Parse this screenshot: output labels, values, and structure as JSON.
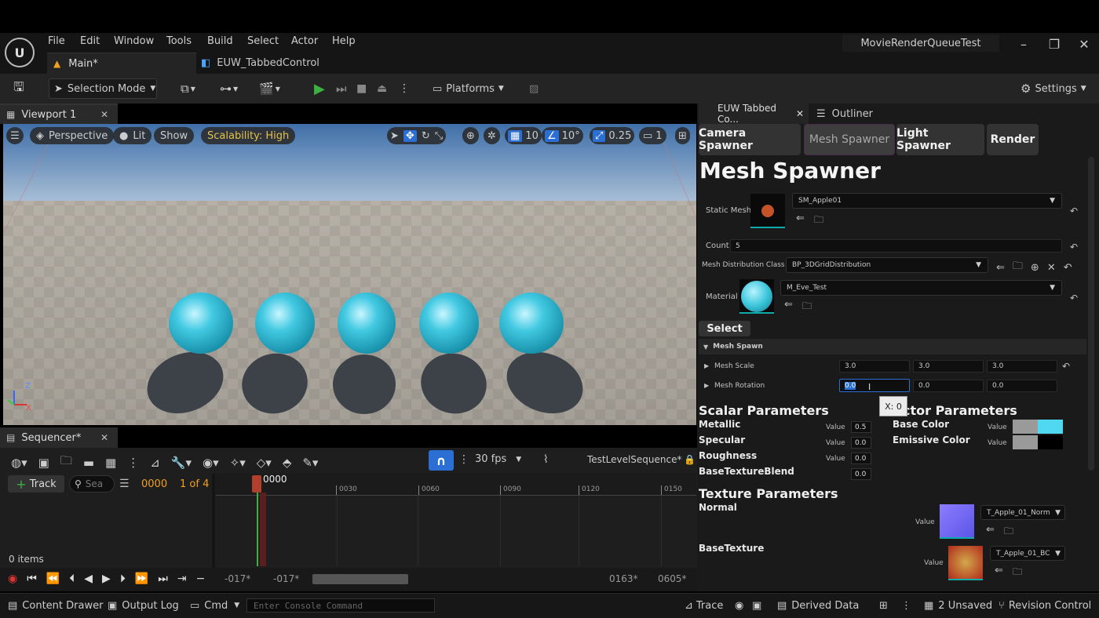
{
  "menu": [
    "File",
    "Edit",
    "Window",
    "Tools",
    "Build",
    "Select",
    "Actor",
    "Help"
  ],
  "tabs": {
    "main": "Main*",
    "euw": "EUW_TabbedControl"
  },
  "project_name": "MovieRenderQueueTest",
  "toolbar": {
    "selection_mode": "Selection Mode",
    "platforms": "Platforms",
    "settings": "Settings"
  },
  "viewport": {
    "tab": "Viewport 1",
    "perspective": "Perspective",
    "lit": "Lit",
    "show": "Show",
    "scalability": "Scalability: High",
    "grid": "10",
    "angle": "10°",
    "scale": "0.25",
    "cam_speed": "1",
    "axis_z": "Z",
    "axis_x": "X"
  },
  "panel": {
    "tab_euw": "EUW Tabbed Co...",
    "tab_outliner": "Outliner",
    "subtabs": [
      "Camera Spawner",
      "Mesh Spawner",
      "Light Spawner",
      "Render"
    ],
    "heading": "Mesh Spawner",
    "static_mesh_label": "Static Mesh",
    "static_mesh_value": "SM_Apple01",
    "count_label": "Count",
    "count_value": "5",
    "dist_label": "Mesh Distribution Class",
    "dist_value": "BP_3DGridDistribution",
    "material_label": "Material",
    "material_value": "M_Eve_Test",
    "select_btn": "Select",
    "mesh_spawn": "Mesh Spawn",
    "mesh_scale_label": "Mesh Scale",
    "mesh_scale": [
      "3.0",
      "3.0",
      "3.0"
    ],
    "mesh_rotation_label": "Mesh Rotation",
    "mesh_rotation": [
      "0.0",
      "0.0",
      "0.0"
    ],
    "tooltip": "X: 0",
    "scalar_title": "Scalar Parameters",
    "vector_title": "ctor Parameters",
    "scalar": [
      {
        "name": "Metallic",
        "value": "0.5"
      },
      {
        "name": "Specular",
        "value": "0.0"
      },
      {
        "name": "Roughness",
        "value": "0.0"
      },
      {
        "name": "BaseTextureBlend",
        "value": "0.0"
      }
    ],
    "vector": [
      {
        "name": "Base Color"
      },
      {
        "name": "Emissive Color"
      }
    ],
    "value_label": "Value",
    "texture_title": "Texture Parameters",
    "textures": [
      {
        "name": "Normal",
        "value": "T_Apple_01_Norm"
      },
      {
        "name": "BaseTexture",
        "value": "T_Apple_01_BC"
      }
    ]
  },
  "sequencer": {
    "tab": "Sequencer*",
    "fps": "30 fps",
    "sequence": "TestLevelSequence*",
    "track_btn": "Track",
    "search_ph": "Sea",
    "frame": "0000",
    "of": "1 of 4",
    "items": "0 items",
    "playhead": "0000",
    "ticks": [
      "0030",
      "0060",
      "0090",
      "0120",
      "0150"
    ],
    "range_start": "-017*",
    "range_start2": "-017*",
    "range_end": "0163*",
    "range_end2": "0605*"
  },
  "status": {
    "content_drawer": "Content Drawer",
    "output_log": "Output Log",
    "cmd": "Cmd",
    "console_ph": "Enter Console Command",
    "trace": "Trace",
    "derived": "Derived Data",
    "unsaved": "2 Unsaved",
    "revision": "Revision Control"
  },
  "colors": {
    "accent": "#2b6fd4",
    "cyan": "#4fd8f0",
    "scalability": "#e6c04a",
    "play": "#3cb043"
  }
}
